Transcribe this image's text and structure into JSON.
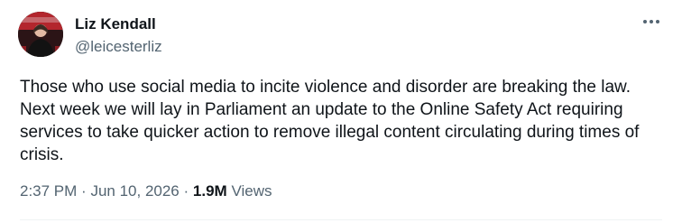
{
  "author": {
    "name": "Liz Kendall",
    "handle": "@leicesterliz",
    "avatar_icon": "profile-photo"
  },
  "menu_icon": "more-horizontal-icon",
  "tweet": {
    "text": "Those who use social media to incite violence and disorder are breaking the law. Next week we will lay in Parliament an update to the Online Safety Act requiring services to take quicker action to remove illegal content circulating during times of crisis."
  },
  "meta": {
    "time": "2:37 PM",
    "date": "Jun 10, 2026",
    "separator": "·",
    "views_count": "1.9M",
    "views_label": "Views"
  },
  "colors": {
    "text": "#0f1419",
    "secondary": "#536471",
    "divider": "#eff3f4"
  }
}
